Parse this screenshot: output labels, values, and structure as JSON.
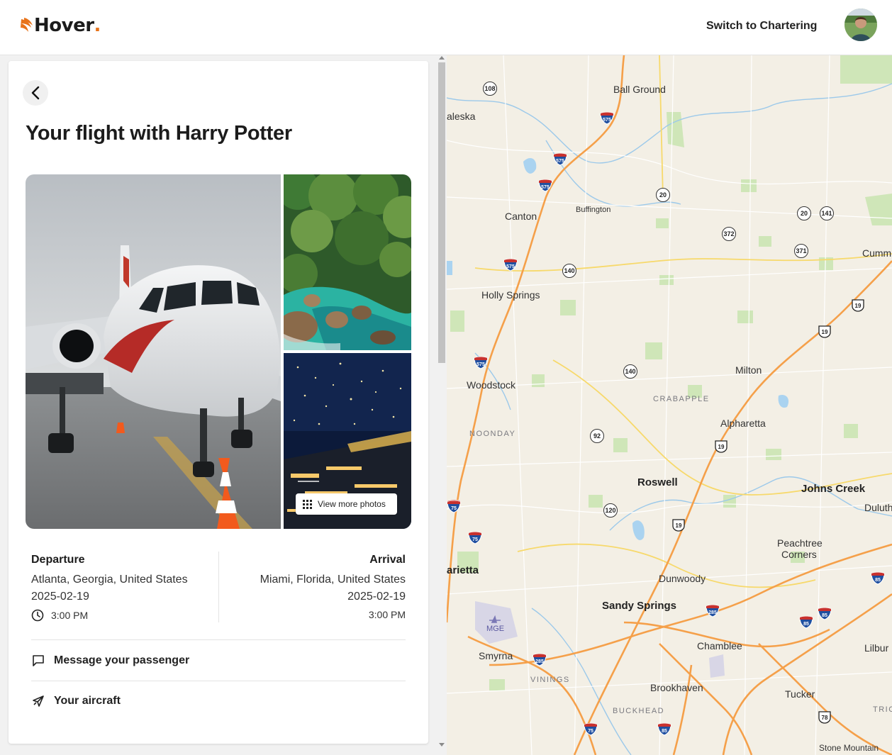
{
  "header": {
    "logo_text": "Hover",
    "switch_label": "Switch to Chartering",
    "colors": {
      "brand_orange": "#e8731a"
    }
  },
  "panel": {
    "title": "Your flight with Harry Potter",
    "gallery": {
      "more_photos_label": "View more photos"
    },
    "departure": {
      "heading": "Departure",
      "location": "Atlanta, Georgia, United States",
      "date": "2025-02-19",
      "time": "3:00 PM"
    },
    "arrival": {
      "heading": "Arrival",
      "location": "Miami, Florida, United States",
      "date": "2025-02-19",
      "time": "3:00 PM"
    },
    "actions": [
      {
        "label": "Message your passenger",
        "icon": "chat-bubble-icon"
      },
      {
        "label": "Your aircraft",
        "icon": "airplane-icon"
      }
    ]
  },
  "map": {
    "places": [
      {
        "name": "Ball Ground"
      },
      {
        "name": "aleska"
      },
      {
        "name": "Canton"
      },
      {
        "name": "Buffington"
      },
      {
        "name": "Holly Springs"
      },
      {
        "name": "Woodstock"
      },
      {
        "name": "Milton"
      },
      {
        "name": "Alpharetta"
      },
      {
        "name": "Roswell"
      },
      {
        "name": "Johns Creek"
      },
      {
        "name": "Dunwoody"
      },
      {
        "name": "Sandy Springs"
      },
      {
        "name": "Peachtree"
      },
      {
        "name": "Corners"
      },
      {
        "name": "arietta"
      },
      {
        "name": "Smyrna"
      },
      {
        "name": "Chamblee"
      },
      {
        "name": "Brookhaven"
      },
      {
        "name": "Tucker"
      },
      {
        "name": "Cumm"
      },
      {
        "name": "Duluth"
      },
      {
        "name": "Lilbur"
      },
      {
        "name": "Stone Mountain"
      },
      {
        "name": "MGE"
      }
    ],
    "districts": [
      "CRABAPPLE",
      "NOONDAY",
      "VININGS",
      "BUCKHEAD",
      "TRIC"
    ],
    "state_routes": [
      "108",
      "20",
      "20",
      "141",
      "372",
      "371",
      "140",
      "140",
      "92",
      "120"
    ],
    "interstates": [
      "575",
      "575",
      "575",
      "575",
      "575",
      "75",
      "75",
      "75",
      "285",
      "285",
      "85",
      "85",
      "85",
      "75",
      "85"
    ],
    "us_routes": [
      "19",
      "19",
      "19",
      "19",
      "78"
    ]
  }
}
